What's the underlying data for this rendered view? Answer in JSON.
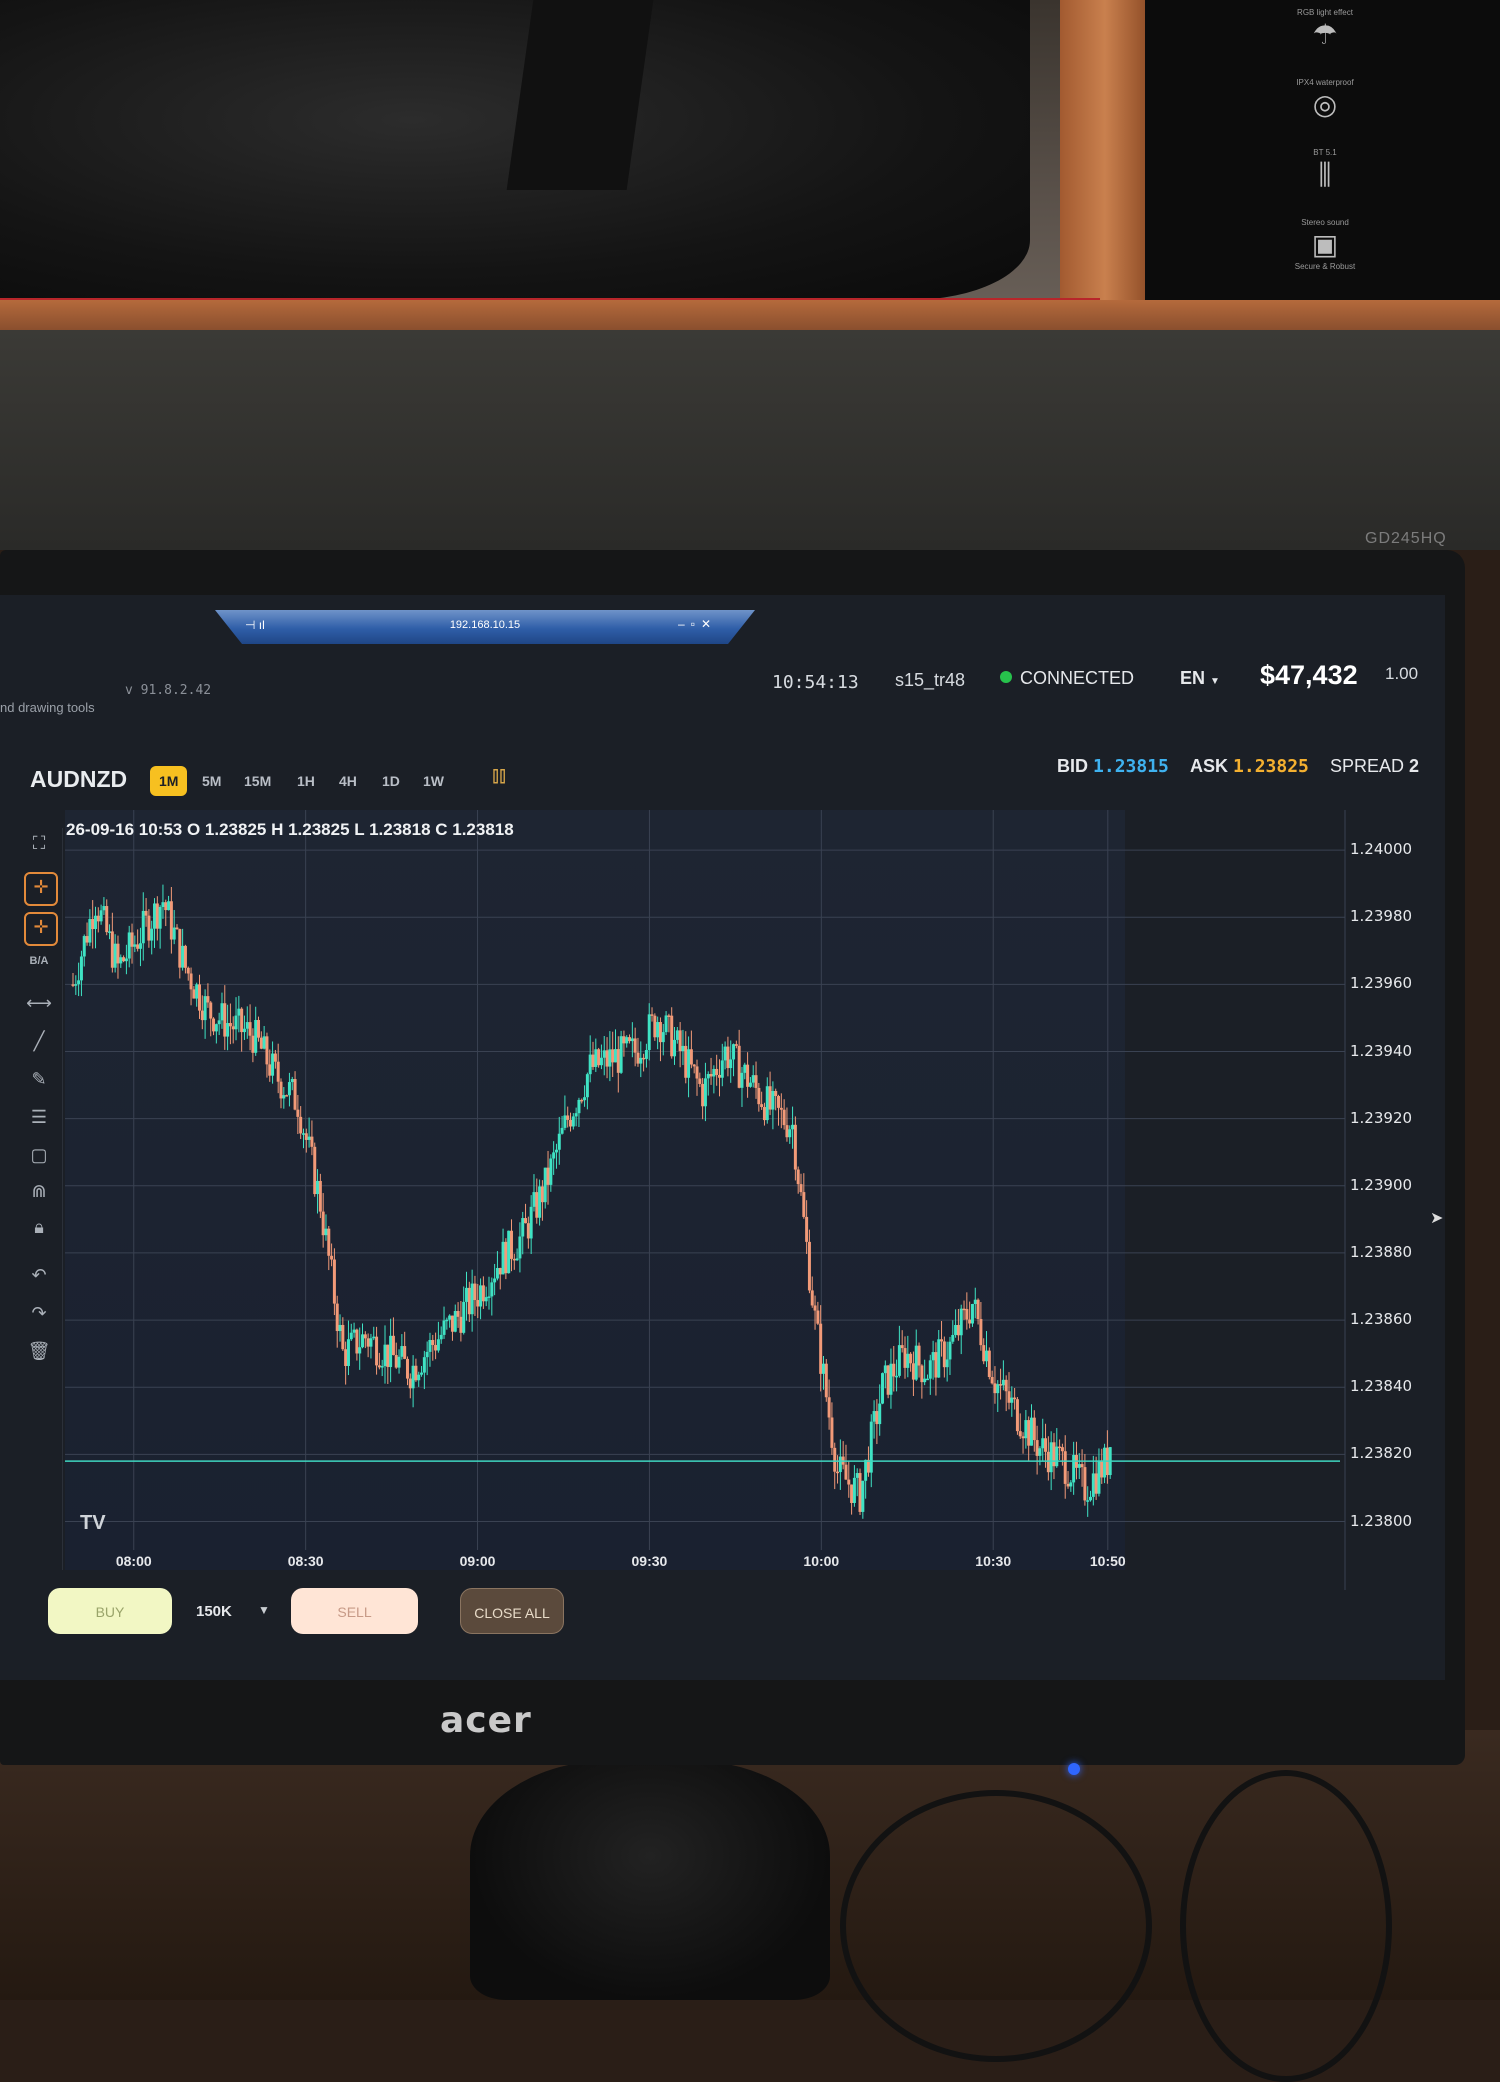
{
  "header": {
    "left_partial": "nd drawing tools",
    "version": "v 91.8.2.42",
    "clock": "10:54:13",
    "account_id": "s15_tr48",
    "connection_status": "CONNECTED",
    "language": "EN",
    "balance": "$47,432",
    "lot_size": "1.00"
  },
  "remote_session": {
    "address": "192.168.10.15"
  },
  "toolbar": {
    "symbol": "AUDNZD",
    "timeframes": [
      "1M",
      "5M",
      "15M",
      "1H",
      "4H",
      "1D",
      "1W"
    ],
    "active_timeframe": "1M",
    "bid_label": "BID",
    "bid_value": "1.23815",
    "ask_label": "ASK",
    "ask_value": "1.23825",
    "spread_label": "SPREAD",
    "spread_value": "2"
  },
  "left_tools": [
    "fullscreen-icon",
    "crosshair-icon",
    "crosshair-alt-icon",
    "B/A",
    "measure-icon",
    "line-icon",
    "pencil-icon",
    "fib-icon",
    "rectangle-icon",
    "magnet-icon",
    "lock-icon",
    "undo-icon",
    "redo-icon",
    "trash-icon"
  ],
  "chart_data": {
    "type": "candlestick",
    "ohlc_readout": "26-09-16 10:53 O 1.23825 H 1.23825 L 1.23818 C 1.23818",
    "y_ticks": [
      "1.24000",
      "1.23980",
      "1.23960",
      "1.23940",
      "1.23920",
      "1.23900",
      "1.23880",
      "1.23860",
      "1.23840",
      "1.23820",
      "1.23800"
    ],
    "ylim": [
      1.23793,
      1.24003
    ],
    "x_ticks": [
      "08:00",
      "08:30",
      "09:00",
      "09:30",
      "10:00",
      "10:30",
      "10:50"
    ],
    "x_range": [
      "07:48",
      "10:53"
    ],
    "bid_line": 1.23818,
    "colors": {
      "up": "#3fe3c4",
      "down": "#f29a78",
      "grid": "#3a4252",
      "bid_line": "#3fd6c0"
    },
    "path_points": [
      [
        0,
        1.2396
      ],
      [
        4,
        1.23985
      ],
      [
        8,
        1.23965
      ],
      [
        12,
        1.23975
      ],
      [
        16,
        1.23985
      ],
      [
        20,
        1.23965
      ],
      [
        24,
        1.23952
      ],
      [
        28,
        1.23948
      ],
      [
        32,
        1.23945
      ],
      [
        36,
        1.23933
      ],
      [
        40,
        1.23925
      ],
      [
        44,
        1.23895
      ],
      [
        48,
        1.2385
      ],
      [
        52,
        1.23855
      ],
      [
        56,
        1.2385
      ],
      [
        60,
        1.23845
      ],
      [
        64,
        1.23853
      ],
      [
        68,
        1.2386
      ],
      [
        72,
        1.23868
      ],
      [
        76,
        1.23878
      ],
      [
        80,
        1.23885
      ],
      [
        84,
        1.239
      ],
      [
        88,
        1.2392
      ],
      [
        92,
        1.23935
      ],
      [
        96,
        1.23938
      ],
      [
        100,
        1.2394
      ],
      [
        104,
        1.2395
      ],
      [
        108,
        1.2394
      ],
      [
        112,
        1.23928
      ],
      [
        116,
        1.2394
      ],
      [
        120,
        1.23932
      ],
      [
        124,
        1.23923
      ],
      [
        128,
        1.23918
      ],
      [
        132,
        1.2386
      ],
      [
        136,
        1.23815
      ],
      [
        140,
        1.23808
      ],
      [
        144,
        1.2384
      ],
      [
        148,
        1.2385
      ],
      [
        152,
        1.23845
      ],
      [
        156,
        1.23852
      ],
      [
        160,
        1.23865
      ],
      [
        164,
        1.23842
      ],
      [
        168,
        1.23832
      ],
      [
        172,
        1.23822
      ],
      [
        176,
        1.23818
      ],
      [
        180,
        1.2381
      ],
      [
        184,
        1.23818
      ],
      [
        186,
        1.2384
      ],
      [
        190,
        1.23852
      ],
      [
        194,
        1.23838
      ],
      [
        198,
        1.2383
      ],
      [
        202,
        1.23815
      ],
      [
        205,
        1.23812
      ]
    ]
  },
  "trade_bar": {
    "buy_label": "BUY",
    "size": "150K",
    "sell_label": "SELL",
    "close_all_label": "CLOSE ALL"
  },
  "device": {
    "brand": "acer",
    "model": "GD245HQ"
  },
  "box_features": [
    "RGB light effect",
    "IPX4 waterproof",
    "BT 5.1",
    "Stereo sound",
    "Secure & Robust"
  ]
}
